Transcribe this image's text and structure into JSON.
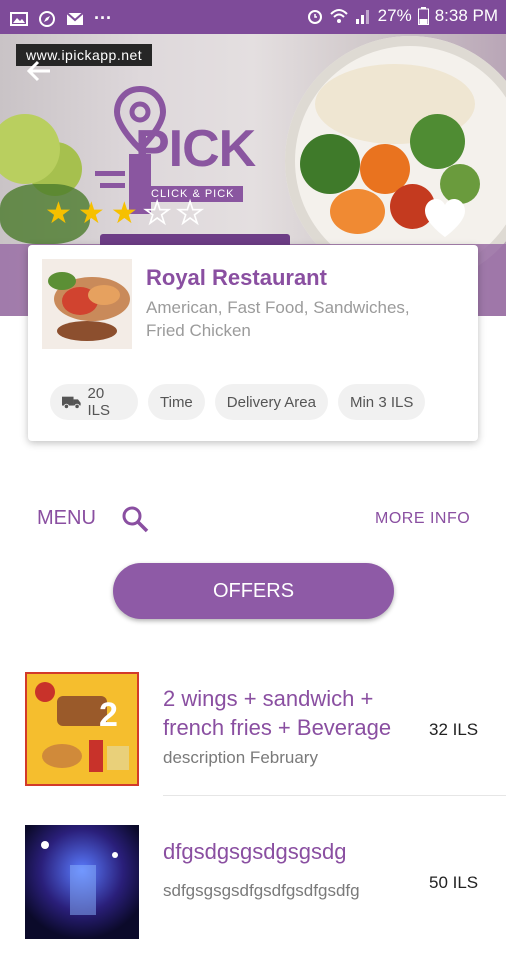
{
  "status_bar": {
    "battery": "27%",
    "time": "8:38 PM",
    "more": "···"
  },
  "hero": {
    "site_tag": "www.ipickapp.net",
    "logo_text": "PICK",
    "logo_sub": "CLICK & PICK",
    "rating": 3,
    "rating_max": 5
  },
  "restaurant": {
    "name": "Royal Restaurant",
    "cuisine": "American, Fast Food, Sandwiches, Fried Chicken",
    "chips": {
      "delivery_fee": "20 ILS",
      "time": "Time",
      "delivery_area": "Delivery Area",
      "minimum": "Min 3 ILS"
    }
  },
  "nav": {
    "menu": "MENU",
    "more_info": "MORE INFO"
  },
  "offers_button": "OFFERS",
  "items": [
    {
      "title": "2 wings + sandwich + french fries + Beverage",
      "description": "description February",
      "price": "32 ILS"
    },
    {
      "title": "dfgsdgsgsdgsgsdg",
      "description": "sdfgsgsgsdfgsdfgsdfgsdfg",
      "price": "50 ILS"
    }
  ],
  "colors": {
    "brand_purple": "#8a4fa1",
    "status_bar": "#7e4b99",
    "star": "#f6c000"
  }
}
